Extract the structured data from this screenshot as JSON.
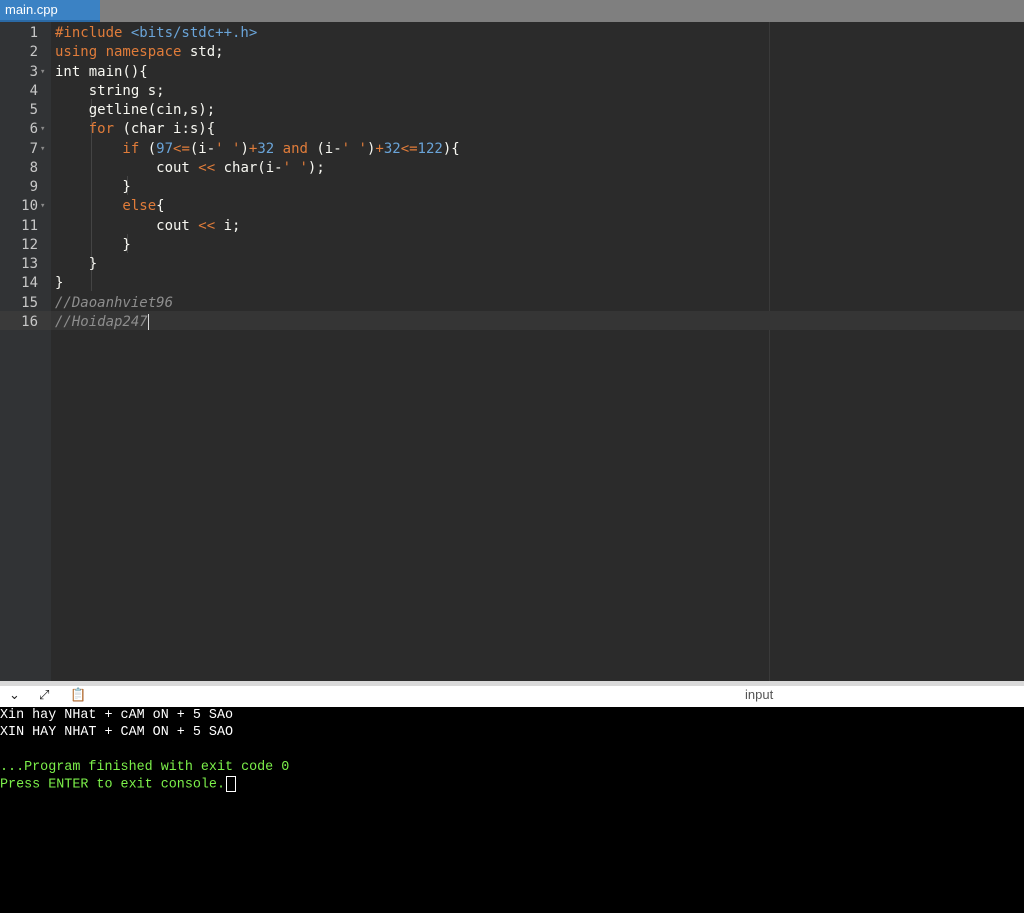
{
  "tab": {
    "title": "main.cpp"
  },
  "editor": {
    "lines": [
      {
        "n": "1",
        "fold": false,
        "tokens": [
          {
            "c": "inc",
            "t": "#include "
          },
          {
            "c": "hdr",
            "t": "<bits/stdc++.h>"
          }
        ]
      },
      {
        "n": "2",
        "fold": false,
        "tokens": [
          {
            "c": "kw",
            "t": "using namespace"
          },
          {
            "c": "",
            "t": " std;"
          }
        ]
      },
      {
        "n": "3",
        "fold": true,
        "tokens": [
          {
            "c": "",
            "t": "int main(){"
          }
        ]
      },
      {
        "n": "4",
        "fold": false,
        "tokens": [
          {
            "c": "",
            "t": "    string s;"
          }
        ]
      },
      {
        "n": "5",
        "fold": false,
        "tokens": [
          {
            "c": "",
            "t": "    getline(cin,s);"
          }
        ]
      },
      {
        "n": "6",
        "fold": true,
        "tokens": [
          {
            "c": "kw",
            "t": "    for"
          },
          {
            "c": "",
            "t": " (char i:s){"
          }
        ]
      },
      {
        "n": "7",
        "fold": true,
        "tokens": [
          {
            "c": "kw",
            "t": "        if"
          },
          {
            "c": "",
            "t": " ("
          },
          {
            "c": "num",
            "t": "97"
          },
          {
            "c": "op",
            "t": "<="
          },
          {
            "c": "",
            "t": "(i-"
          },
          {
            "c": "op",
            "t": "' '"
          },
          {
            "c": "",
            "t": ")"
          },
          {
            "c": "op",
            "t": "+"
          },
          {
            "c": "num",
            "t": "32"
          },
          {
            "c": "",
            "t": " "
          },
          {
            "c": "kw",
            "t": "and"
          },
          {
            "c": "",
            "t": " (i-"
          },
          {
            "c": "op",
            "t": "' '"
          },
          {
            "c": "",
            "t": ")"
          },
          {
            "c": "op",
            "t": "+"
          },
          {
            "c": "num",
            "t": "32"
          },
          {
            "c": "op",
            "t": "<="
          },
          {
            "c": "num",
            "t": "122"
          },
          {
            "c": "",
            "t": "){"
          }
        ]
      },
      {
        "n": "8",
        "fold": false,
        "tokens": [
          {
            "c": "",
            "t": "            cout "
          },
          {
            "c": "op",
            "t": "<<"
          },
          {
            "c": "",
            "t": " char(i-"
          },
          {
            "c": "op",
            "t": "' '"
          },
          {
            "c": "",
            "t": ");"
          }
        ]
      },
      {
        "n": "9",
        "fold": false,
        "tokens": [
          {
            "c": "",
            "t": "        }"
          }
        ]
      },
      {
        "n": "10",
        "fold": true,
        "tokens": [
          {
            "c": "kw",
            "t": "        else"
          },
          {
            "c": "",
            "t": "{"
          }
        ]
      },
      {
        "n": "11",
        "fold": false,
        "tokens": [
          {
            "c": "",
            "t": "            cout "
          },
          {
            "c": "op",
            "t": "<<"
          },
          {
            "c": "",
            "t": " i;"
          }
        ]
      },
      {
        "n": "12",
        "fold": false,
        "tokens": [
          {
            "c": "",
            "t": "        }"
          }
        ]
      },
      {
        "n": "13",
        "fold": false,
        "tokens": [
          {
            "c": "",
            "t": "    }"
          }
        ]
      },
      {
        "n": "14",
        "fold": false,
        "tokens": [
          {
            "c": "",
            "t": "}"
          }
        ]
      },
      {
        "n": "15",
        "fold": false,
        "tokens": [
          {
            "c": "cmt",
            "t": "//Daoanhviet96"
          }
        ]
      },
      {
        "n": "16",
        "fold": false,
        "cursor": true,
        "tokens": [
          {
            "c": "cmt",
            "t": "//Hoidap247"
          }
        ]
      }
    ]
  },
  "console_toolbar": {
    "collapse_icon": "chevron-down-icon",
    "expand_icon": "expand-icon",
    "copy_icon": "clipboard-icon",
    "input_label": "input"
  },
  "console": {
    "output": [
      "Xin hay NHat + cAM oN + 5 SAo",
      "XIN HAY NHAT + CAM ON + 5 SAO",
      ""
    ],
    "status": "...Program finished with exit code 0",
    "prompt": "Press ENTER to exit console."
  },
  "colors": {
    "tab_active": "#3b82c4",
    "editor_bg": "#2b2b2b",
    "keyword": "#e07c3a",
    "number": "#6aa4d8",
    "comment": "#8e8e8e",
    "console_success": "#7cf04a"
  }
}
